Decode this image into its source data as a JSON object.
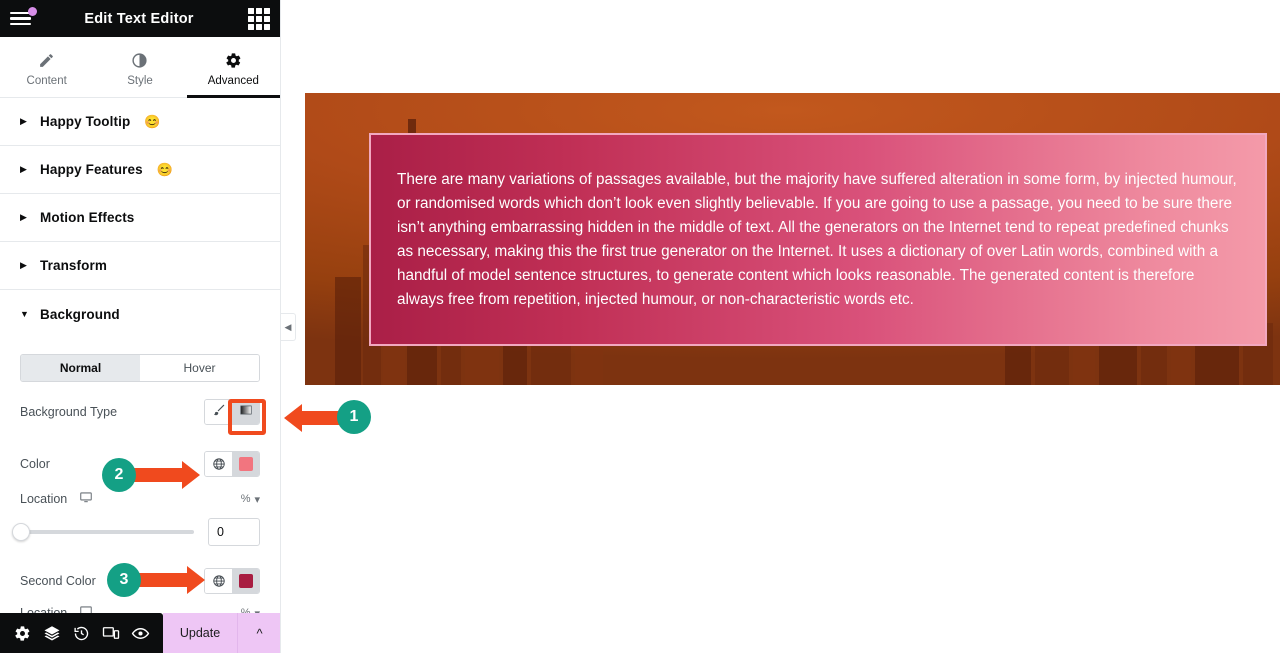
{
  "app": {
    "header": {
      "title": "Edit Text Editor",
      "menu_icon": "hamburger-icon",
      "apps_icon": "grid-apps-icon",
      "notification_dot": "#d78ee8"
    },
    "tabs": [
      {
        "label": "Content",
        "icon": "pencil-icon",
        "active": false
      },
      {
        "label": "Style",
        "icon": "contrast-half-circle-icon",
        "active": false
      },
      {
        "label": "Advanced",
        "icon": "gear-icon",
        "active": true
      }
    ],
    "sections": [
      {
        "label": "Happy Tooltip",
        "emoji": "😊",
        "expanded": false
      },
      {
        "label": "Happy Features",
        "emoji": "😊",
        "expanded": false
      },
      {
        "label": "Motion Effects",
        "emoji": "",
        "expanded": false
      },
      {
        "label": "Transform",
        "emoji": "",
        "expanded": false
      },
      {
        "label": "Background",
        "emoji": "",
        "expanded": true
      }
    ],
    "background_panel": {
      "state_tabs": {
        "normal": "Normal",
        "hover": "Hover",
        "selected": "Normal"
      },
      "background_type": {
        "label": "Background Type",
        "options": [
          {
            "name": "classic",
            "icon": "paint-brush-icon",
            "selected": false
          },
          {
            "name": "gradient",
            "icon": "gradient-square-icon",
            "selected": true
          }
        ]
      },
      "color": {
        "label": "Color",
        "globe_icon": "globe-icon",
        "swatch": "#f2757f"
      },
      "location_1": {
        "label": "Location",
        "device_icon": "desktop-icon",
        "unit": "%",
        "unit_caret": "chevron-down-icon",
        "value": "0",
        "slider_percent": 0
      },
      "second_color": {
        "label": "Second Color",
        "globe_icon": "globe-icon",
        "swatch": "#a81d41"
      },
      "location_2": {
        "label": "Location",
        "device_icon": "desktop-icon"
      }
    },
    "collapse_handle_icon": "chevron-left-icon",
    "bottom_bar": {
      "icons": [
        {
          "name": "settings-gear-icon"
        },
        {
          "name": "navigator-layers-icon"
        },
        {
          "name": "history-clock-icon"
        },
        {
          "name": "responsive-mode-icon"
        },
        {
          "name": "preview-eye-icon"
        }
      ],
      "update_label": "Update",
      "caret_icon": "chevron-up-icon",
      "update_color": "#eec6f5"
    }
  },
  "canvas": {
    "text_block": {
      "body": "There are many variations of passages available, but the majority have suffered alteration in some form, by injected humour, or randomised words which don’t look even slightly believable. If you are going to use a passage, you need to be sure there isn’t anything embarrassing hidden in the middle of text. All the generators on the Internet tend to repeat predefined chunks as necessary, making this the first true generator on the Internet. It uses a dictionary of over Latin words, combined with a handful of model sentence structures, to generate content which looks reasonable. The generated content is therefore always free from repetition, injected humour, or non-characteristic words etc.",
      "gradient_start": "#aa1f47",
      "gradient_end": "#f49aa9",
      "border_color": "#f2a8c0",
      "text_color": "#ffffff"
    },
    "hero_background": "orange-cityscape-photo"
  },
  "annotations": {
    "accent_circle": "#14a085",
    "accent_arrow": "#f04a1e",
    "markers": [
      {
        "number": "1",
        "points_to": "background-type-gradient-button"
      },
      {
        "number": "2",
        "points_to": "color-swatch-button"
      },
      {
        "number": "3",
        "points_to": "second-color-swatch-button"
      }
    ]
  }
}
